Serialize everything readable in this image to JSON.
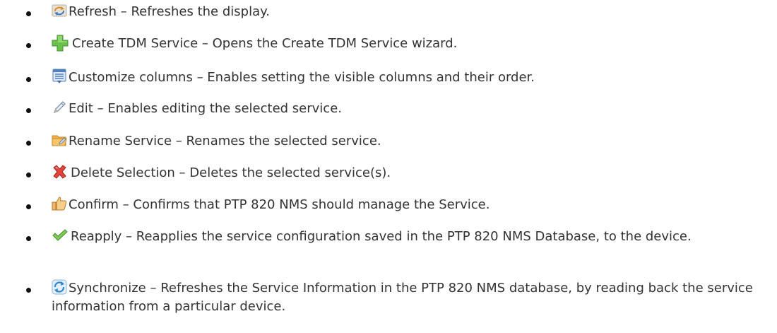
{
  "items": [
    {
      "icon": "refresh-icon",
      "label": "Refresh",
      "sep": " – ",
      "description": "Refreshes the display."
    },
    {
      "icon": "plus-icon",
      "label": "Create TDM Service",
      "sep": " – ",
      "description": "Opens the Create TDM Service wizard."
    },
    {
      "icon": "columns-icon",
      "label": "Customize columns",
      "sep": " – ",
      "description": "Enables setting the visible columns and their order."
    },
    {
      "icon": "pencil-icon",
      "label": "Edit",
      "sep": " – ",
      "description": "Enables editing the selected service."
    },
    {
      "icon": "folder-rename-icon",
      "label": "Rename Service",
      "sep": " – ",
      "description": "Renames the selected service."
    },
    {
      "icon": "delete-x-icon",
      "label": "Delete Selection",
      "sep": " – ",
      "description": "Deletes the selected service(s)."
    },
    {
      "icon": "thumbs-up-icon",
      "label": "Confirm",
      "sep": " – ",
      "description": "Confirms that PTP 820 NMS should manage the Service."
    },
    {
      "icon": "checkmark-icon",
      "label": "Reapply",
      "sep": " – ",
      "description": "Reapplies the service configuration saved in the PTP 820 NMS Database, to the device."
    },
    {
      "icon": "synchronize-icon",
      "label": "Synchronize",
      "sep": " – ",
      "description": "Refreshes the Service Information in the PTP 820 NMS database, by reading back the service information from a particular device."
    }
  ]
}
